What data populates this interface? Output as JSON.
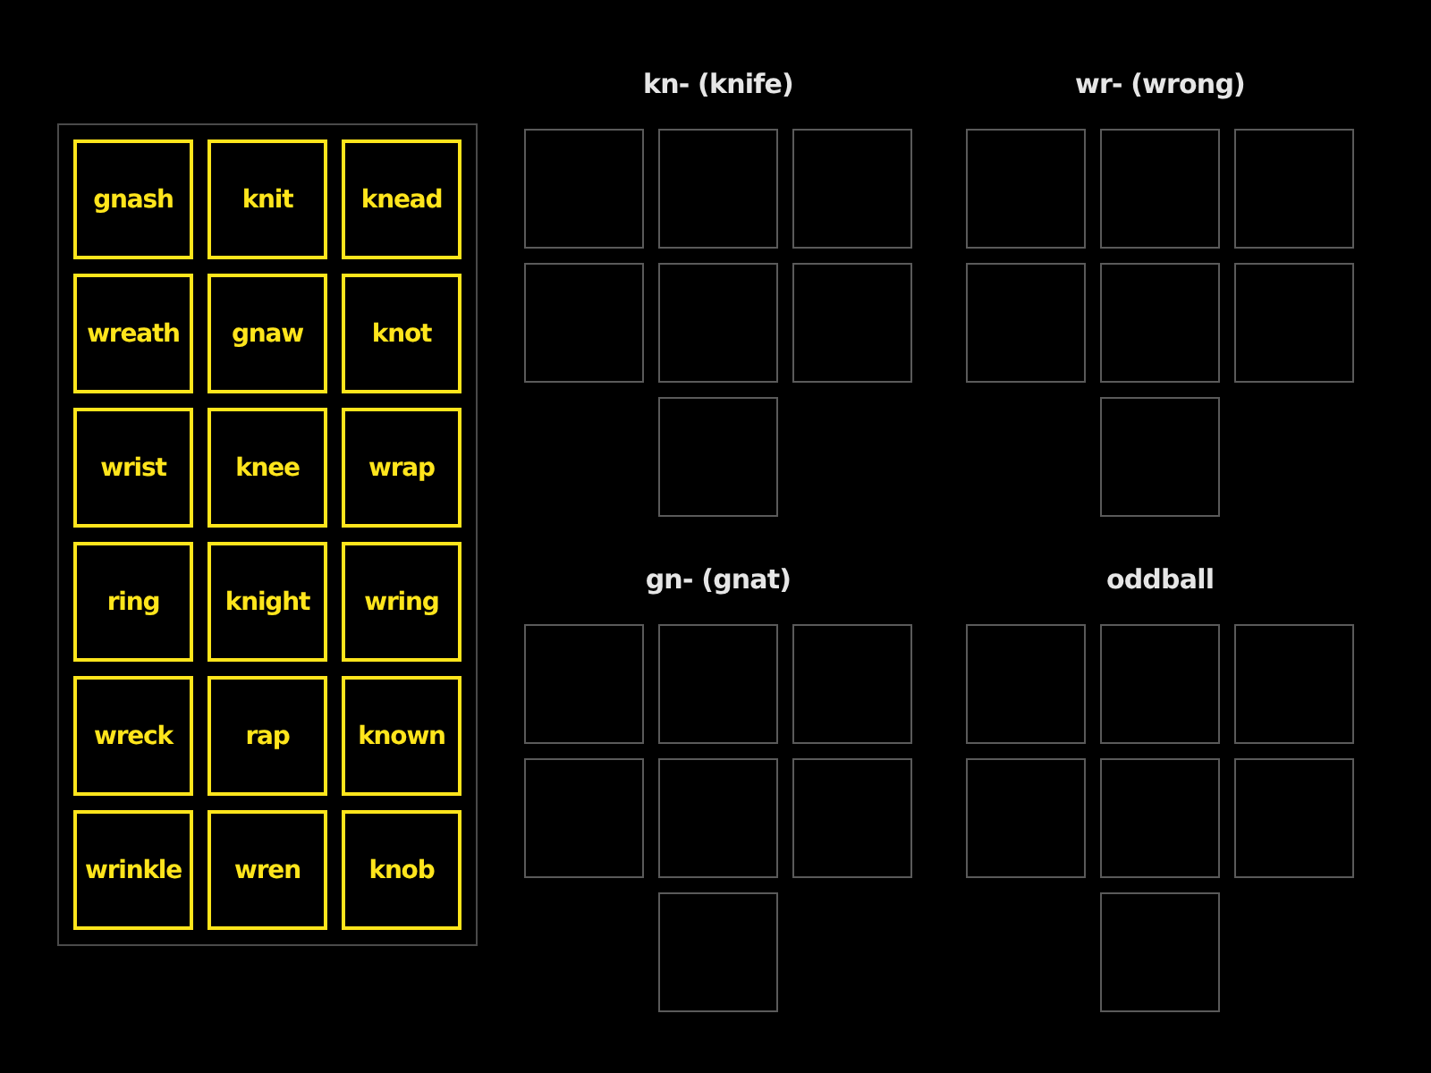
{
  "tiles": [
    {
      "label": "gnash"
    },
    {
      "label": "knit"
    },
    {
      "label": "knead"
    },
    {
      "label": "wreath"
    },
    {
      "label": "gnaw"
    },
    {
      "label": "knot"
    },
    {
      "label": "wrist"
    },
    {
      "label": "knee"
    },
    {
      "label": "wrap"
    },
    {
      "label": "ring"
    },
    {
      "label": "knight"
    },
    {
      "label": "wring"
    },
    {
      "label": "wreck"
    },
    {
      "label": "rap"
    },
    {
      "label": "known"
    },
    {
      "label": "wrinkle"
    },
    {
      "label": "wren"
    },
    {
      "label": "knob"
    }
  ],
  "groups": [
    {
      "title": "kn- (knife)",
      "slots": [
        {
          "kind": "empty"
        },
        {
          "kind": "empty"
        },
        {
          "kind": "empty"
        },
        {
          "kind": "empty"
        },
        {
          "kind": "empty"
        },
        {
          "kind": "empty"
        },
        {
          "kind": "empty"
        }
      ]
    },
    {
      "title": "wr- (wrong)",
      "slots": [
        {
          "kind": "empty"
        },
        {
          "kind": "empty"
        },
        {
          "kind": "empty"
        },
        {
          "kind": "empty"
        },
        {
          "kind": "empty"
        },
        {
          "kind": "empty"
        },
        {
          "kind": "empty"
        }
      ]
    },
    {
      "title": "gn- (gnat)",
      "slots": [
        {
          "kind": "empty"
        },
        {
          "kind": "empty"
        },
        {
          "kind": "empty"
        },
        {
          "kind": "empty"
        },
        {
          "kind": "empty"
        },
        {
          "kind": "empty"
        },
        {
          "kind": "empty"
        }
      ]
    },
    {
      "title": "oddball",
      "slots": [
        {
          "kind": "empty"
        },
        {
          "kind": "empty"
        },
        {
          "kind": "empty"
        },
        {
          "kind": "empty"
        },
        {
          "kind": "empty"
        },
        {
          "kind": "empty"
        },
        {
          "kind": "empty"
        }
      ]
    }
  ]
}
